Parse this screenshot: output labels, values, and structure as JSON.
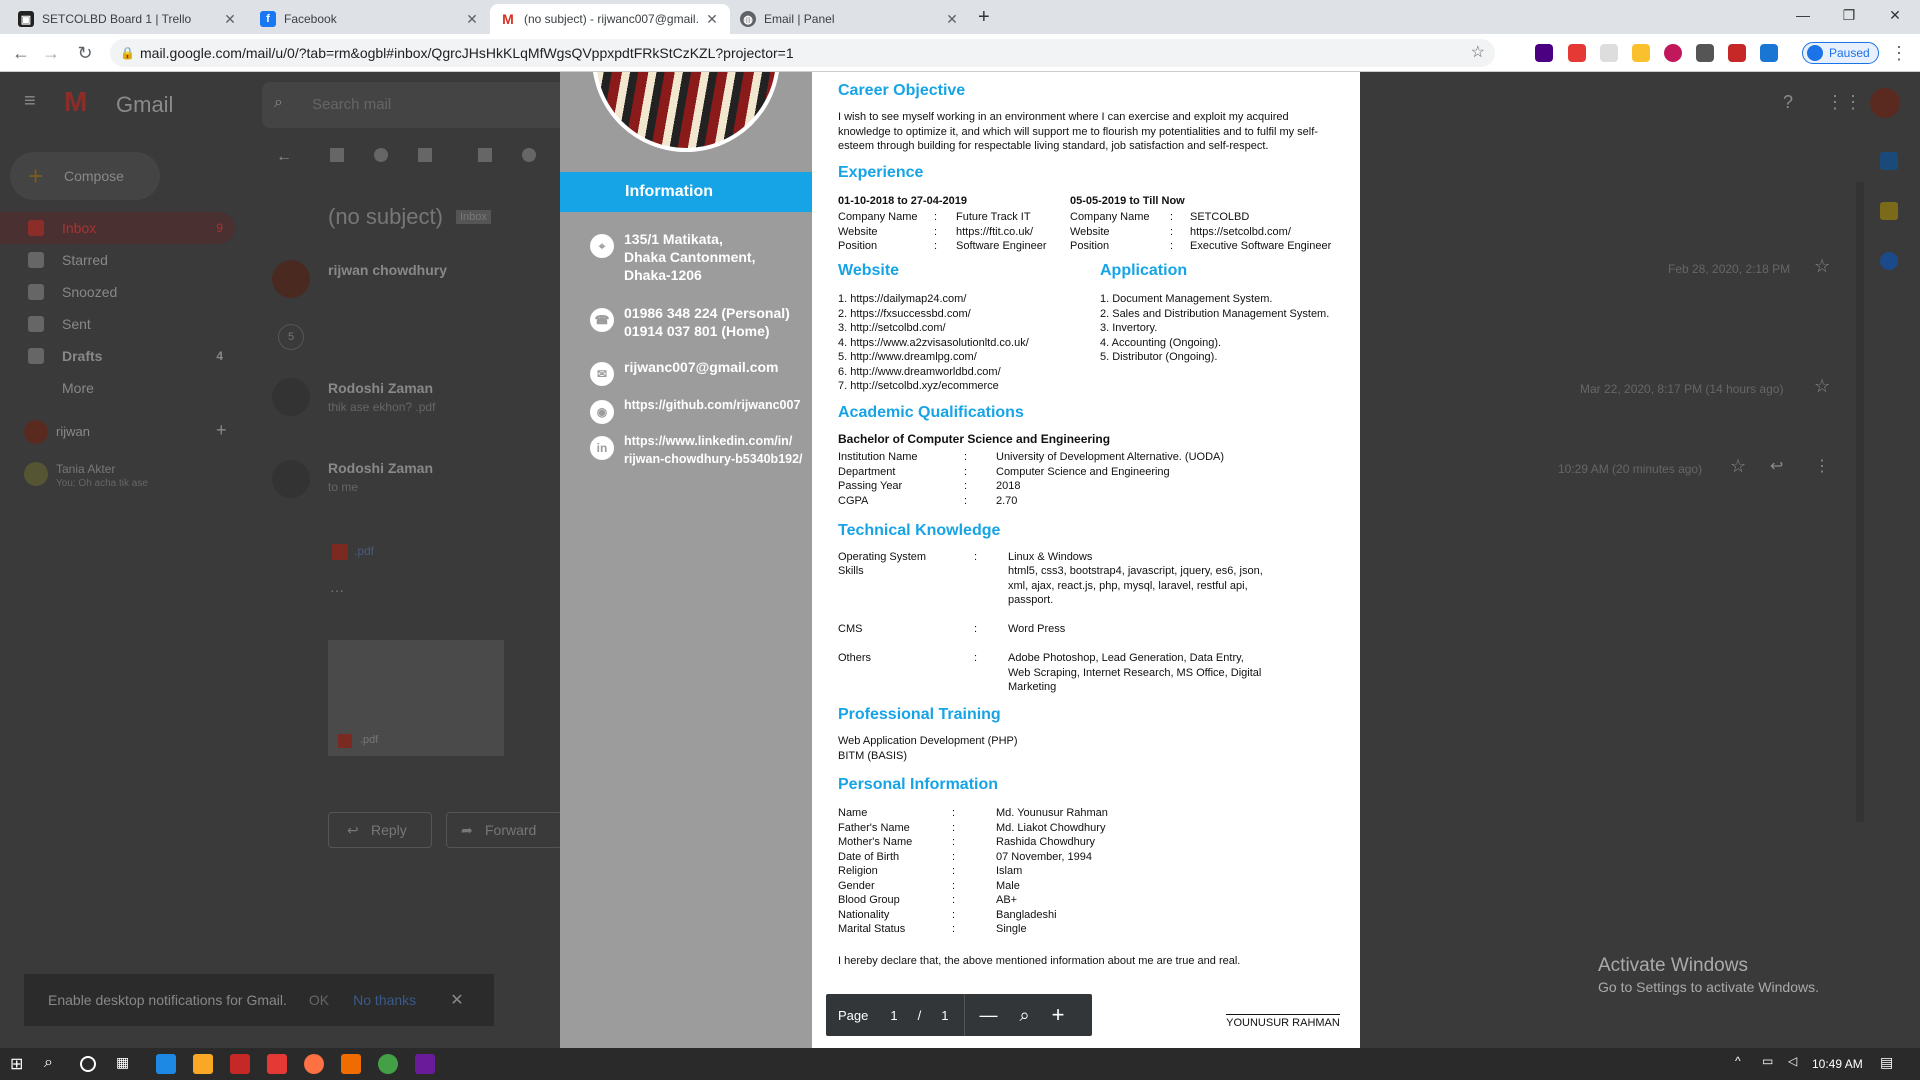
{
  "browser": {
    "tabs": [
      {
        "title": "SETCOLBD Board 1 | Trello",
        "icon": "trello-icon",
        "color": "#222"
      },
      {
        "title": "Facebook",
        "icon": "facebook-icon",
        "color": "#1877f2"
      },
      {
        "title": "(no subject) - rijwanc007@gmail.",
        "icon": "gmail-icon",
        "color": "#d93025"
      },
      {
        "title": "Email | Panel",
        "icon": "globe-icon",
        "color": "#5f6368"
      }
    ],
    "url": "mail.google.com/mail/u/0/?tab=rm&ogbl#inbox/QgrcJHsHkKLqMfWgsQVppxpdtFRkStCzKZL?projector=1",
    "profile_status": "Paused"
  },
  "gmail": {
    "app_name": "Gmail",
    "search_placeholder": "Search mail",
    "compose": "Compose",
    "nav": [
      {
        "label": "Inbox",
        "count": "9"
      },
      {
        "label": "Starred",
        "count": ""
      },
      {
        "label": "Snoozed",
        "count": ""
      },
      {
        "label": "Sent",
        "count": ""
      },
      {
        "label": "Drafts",
        "count": "4"
      },
      {
        "label": "More",
        "count": ""
      }
    ],
    "account": "rijwan",
    "hangout": {
      "name": "Tania Akter",
      "preview": "You: Oh acha tik ase"
    },
    "subject": "(no subject)",
    "label": "Inbox",
    "messages": [
      {
        "sender": "rijwan chowdhury",
        "preview": "",
        "time": "Feb 28, 2020, 2:18 PM"
      },
      {
        "sender": "Rodoshi Zaman",
        "preview": "thik ase ekhon?  .pdf",
        "time": "Mar 22, 2020, 8:17 PM (14 hours ago)"
      },
      {
        "sender": "Rodoshi Zaman",
        "preview": "to me",
        "time": "10:29 AM (20 minutes ago)"
      }
    ],
    "collapsed_count": "5",
    "attachment": ".pdf",
    "attachment2": ".pdf",
    "reply": "Reply",
    "forward": "Forward",
    "notification": {
      "text": "Enable desktop notifications for Gmail.",
      "ok": "OK",
      "no": "No thanks"
    }
  },
  "cv": {
    "info_title": "Information",
    "address": [
      "135/1 Matikata,",
      "Dhaka Cantonment,",
      "Dhaka-1206"
    ],
    "phones": [
      "01986 348 224 (Personal)",
      "01914 037 801 (Home)"
    ],
    "email": "rijwanc007@gmail.com",
    "github": "https://github.com/rijwanc007",
    "linkedin": [
      "https://www.linkedin.com/in/",
      "rijwan-chowdhury-b5340b192/"
    ],
    "career_h": "Career Objective",
    "career": "I wish to see myself working in an environment where I can exercise and exploit my acquired knowledge to optimize it, and which will support me to flourish my potentialities and to fulfil my self-esteem through building for respectable living standard, job satisfaction and self-respect.",
    "exp_h": "Experience",
    "exp": [
      {
        "period": "01-10-2018 to 27-04-2019",
        "company": "Future Track IT",
        "website": "https://ftit.co.uk/",
        "position": "Software Engineer"
      },
      {
        "period": "05-05-2019 to Till Now",
        "company": "SETCOLBD",
        "website": "https://setcolbd.com/",
        "position": "Executive Software Engineer"
      }
    ],
    "lbl_company": "Company Name",
    "lbl_website": "Website",
    "lbl_position": "Position",
    "colon": ":",
    "web_h": "Website",
    "websites": [
      "1. https://dailymap24.com/",
      "2. https://fxsuccessbd.com/",
      "3. http://setcolbd.com/",
      "4. https://www.a2zvisasolutionltd.co.uk/",
      "5. http://www.dreamlpg.com/",
      "6. http://www.dreamworldbd.com/",
      "7. http://setcolbd.xyz/ecommerce"
    ],
    "app_h": "Application",
    "apps": [
      "1. Document Management System.",
      "2. Sales and Distribution Management System.",
      "3. Invertory.",
      "4. Accounting (Ongoing).",
      "5. Distributor (Ongoing)."
    ],
    "acad_h": "Academic Qualifications",
    "degree": "Bachelor of Computer Science and Engineering",
    "acad": [
      [
        "Institution Name",
        "University of Development Alternative. (UODA)"
      ],
      [
        "Department",
        "Computer Science and Engineering"
      ],
      [
        "Passing Year",
        "2018"
      ],
      [
        "CGPA",
        "2.70"
      ]
    ],
    "tech_h": "Technical Knowledge",
    "tech": [
      [
        "Operating System",
        "Linux & Windows"
      ],
      [
        "Skills",
        "html5, css3, bootstrap4, javascript, jquery, es6, json, xml, ajax, react.js, php, mysql, laravel, restful api, passport."
      ],
      [
        "CMS",
        "Word Press"
      ],
      [
        "Others",
        "Adobe Photoshop, Lead Generation, Data Entry, Web Scraping, Internet Research, MS Office, Digital Marketing"
      ]
    ],
    "train_h": "Professional Training",
    "training": [
      "Web Application Development (PHP)",
      "BITM (BASIS)"
    ],
    "pers_h": "Personal Information",
    "personal": [
      [
        "Name",
        "Md. Younusur Rahman"
      ],
      [
        "Father's Name",
        "Md. Liakot Chowdhury"
      ],
      [
        "Mother's Name",
        "Rashida Chowdhury"
      ],
      [
        "Date of Birth",
        "07 November, 1994"
      ],
      [
        "Religion",
        "Islam"
      ],
      [
        "Gender",
        "Male"
      ],
      [
        "Blood Group",
        "AB+"
      ],
      [
        "Nationality",
        "Bangladeshi"
      ],
      [
        "Marital Status",
        "Single"
      ]
    ],
    "declaration": "I hereby declare that, the above mentioned information about me are true and real.",
    "signature": "YOUNUSUR RAHMAN"
  },
  "pager": {
    "label": "Page",
    "current": "1",
    "sep": "/",
    "total": "1"
  },
  "windows": {
    "activate_title": "Activate Windows",
    "activate_sub": "Go to Settings to activate Windows.",
    "time": "10:49 AM"
  }
}
